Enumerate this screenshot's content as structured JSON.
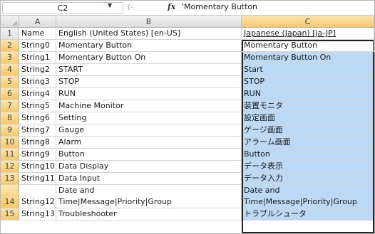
{
  "formula_bar": {
    "name_box": "C2",
    "fx_label": "fx",
    "content": "'Momentary Button"
  },
  "columns": [
    "A",
    "B",
    "C"
  ],
  "rows": [
    {
      "num": "1",
      "a": "Name",
      "b": "English (United States) [en-US]",
      "c": "Japanese (Japan) [ja-JP]"
    },
    {
      "num": "2",
      "a": "String0",
      "b": "Momentary Button",
      "c": "Momentary Button"
    },
    {
      "num": "3",
      "a": "String1",
      "b": "Momentary Button On",
      "c": "Momentary Button On"
    },
    {
      "num": "4",
      "a": "String2",
      "b": "START",
      "c": "Start"
    },
    {
      "num": "5",
      "a": "String3",
      "b": "STOP",
      "c": "STOP"
    },
    {
      "num": "6",
      "a": "String4",
      "b": "RUN",
      "c": "RUN"
    },
    {
      "num": "7",
      "a": "String5",
      "b": "Machine Monitor",
      "c": "装置モニタ"
    },
    {
      "num": "8",
      "a": "String6",
      "b": "Setting",
      "c": "設定画面"
    },
    {
      "num": "9",
      "a": "String7",
      "b": "Gauge",
      "c": "ゲージ画面"
    },
    {
      "num": "10",
      "a": "String8",
      "b": "Alarm",
      "c": "アラーム画面"
    },
    {
      "num": "11",
      "a": "String9",
      "b": "Button",
      "c": "Button"
    },
    {
      "num": "12",
      "a": "String10",
      "b": "Data Display",
      "c": "データ表示"
    },
    {
      "num": "13",
      "a": "String11",
      "b": "Data Input",
      "c": "データ入力"
    },
    {
      "num": "14",
      "a": "String12",
      "b_line1": "Date and",
      "b_line2": "Time|Message|Priority|Group",
      "c_line1": "Date and",
      "c_line2": "Time|Message|Priority|Group"
    },
    {
      "num": "15",
      "a": "String13",
      "b": "Troubleshooter",
      "c": "トラブルシュータ"
    }
  ]
}
